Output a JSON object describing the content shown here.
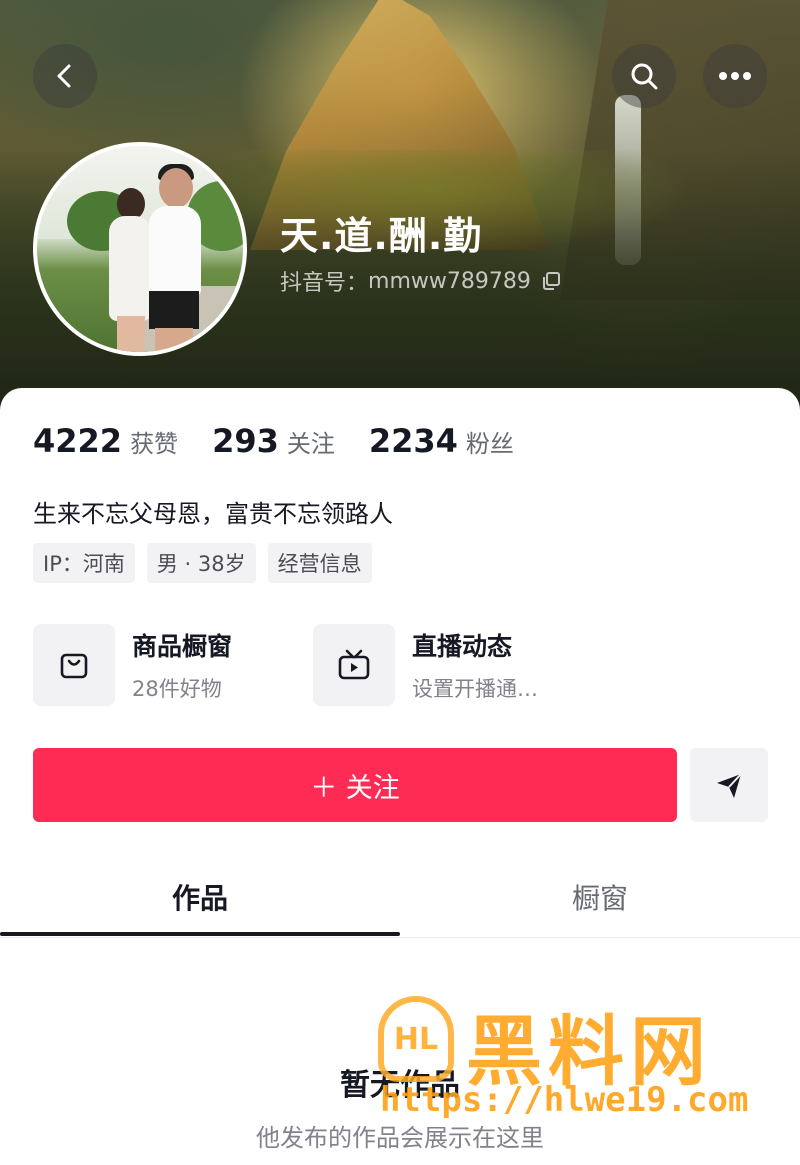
{
  "header": {
    "nickname": "天.道.酬.勤",
    "account_label": "抖音号：",
    "account_id": "mmww789789"
  },
  "stats": [
    {
      "value": "4222",
      "label": "获赞"
    },
    {
      "value": "293",
      "label": "关注"
    },
    {
      "value": "2234",
      "label": "粉丝"
    }
  ],
  "bio": "生来不忘父母恩，富贵不忘领路人",
  "tags": [
    "IP：河南",
    "男 · 38岁",
    "经营信息"
  ],
  "entries": [
    {
      "title": "商品橱窗",
      "subtitle": "28件好物",
      "icon": "shopping-bag-icon"
    },
    {
      "title": "直播动态",
      "subtitle": "设置开播通…",
      "icon": "tv-icon"
    }
  ],
  "actions": {
    "follow_label": "＋ 关注"
  },
  "tabs": [
    {
      "label": "作品",
      "active": true
    },
    {
      "label": "橱窗",
      "active": false
    }
  ],
  "empty_state": {
    "title": "暂无作品",
    "subtitle": "他发布的作品会展示在这里"
  },
  "watermark": {
    "mark": "HL",
    "name": "黑料网",
    "url": "https://hlwe19.com"
  },
  "colors": {
    "accent": "#fe2c55",
    "text_primary": "#161823",
    "text_secondary": "#80838b",
    "chip_bg": "#f2f2f4",
    "watermark": "#ffa014"
  }
}
